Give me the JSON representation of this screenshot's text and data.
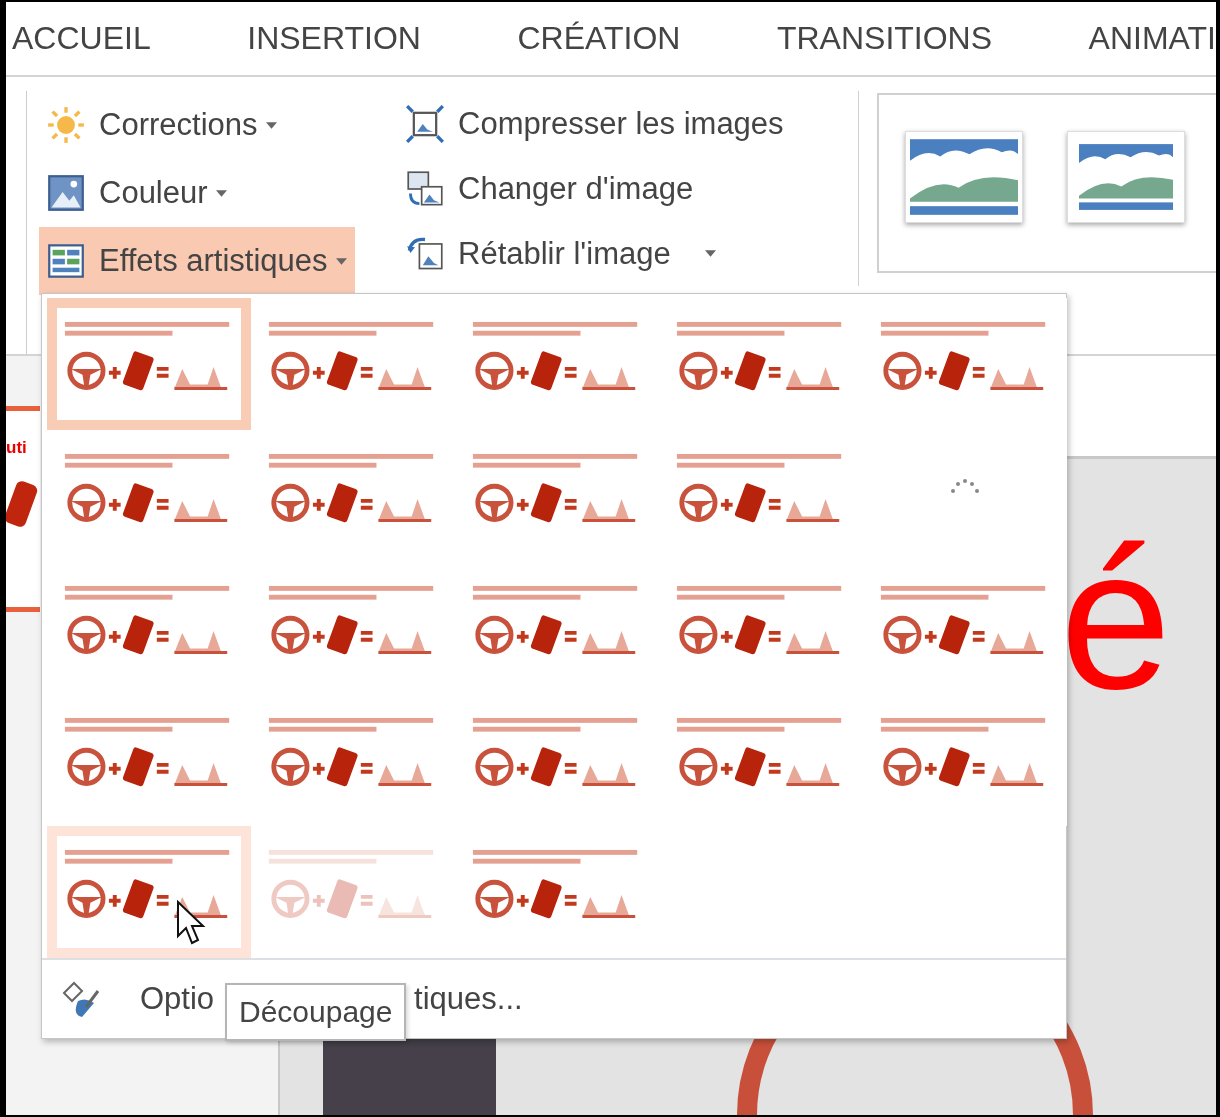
{
  "tabs": [
    {
      "label": "ACCUEIL",
      "selected": false
    },
    {
      "label": "INSERTION",
      "selected": false
    },
    {
      "label": "CRÉATION",
      "selected": false
    },
    {
      "label": "TRANSITIONS",
      "selected": false
    },
    {
      "label": "ANIMATI",
      "selected": false
    }
  ],
  "ribbon": {
    "columns": [
      [
        {
          "kind": "corrections",
          "label": "Corrections",
          "dropdown": true,
          "active": false
        },
        {
          "kind": "color",
          "label": "Couleur",
          "dropdown": true,
          "active": false
        },
        {
          "kind": "artistic",
          "label": "Effets artistiques",
          "dropdown": true,
          "active": true
        }
      ],
      [
        {
          "kind": "compress",
          "label": "Compresser les images",
          "dropdown": false,
          "active": false
        },
        {
          "kind": "change",
          "label": "Changer d'image",
          "dropdown": false,
          "active": false
        },
        {
          "kind": "reset",
          "label": "Rétablir l'image",
          "dropdown": true,
          "active": false
        }
      ]
    ],
    "picture_styles": [
      {
        "kind": "thick-frame"
      },
      {
        "kind": "thin-frame"
      }
    ]
  },
  "effects_menu": {
    "items": [
      {
        "kind": "effect",
        "selected": true,
        "hovered": false
      },
      {
        "kind": "effect",
        "selected": false,
        "hovered": false
      },
      {
        "kind": "effect",
        "selected": false,
        "hovered": false
      },
      {
        "kind": "effect",
        "selected": false,
        "hovered": false
      },
      {
        "kind": "effect",
        "selected": false,
        "hovered": false
      },
      {
        "kind": "effect",
        "selected": false,
        "hovered": false
      },
      {
        "kind": "effect",
        "selected": false,
        "hovered": false
      },
      {
        "kind": "effect",
        "selected": false,
        "hovered": false
      },
      {
        "kind": "effect",
        "selected": false,
        "hovered": false
      },
      {
        "kind": "loading",
        "selected": false,
        "hovered": false
      },
      {
        "kind": "effect",
        "selected": false,
        "hovered": false
      },
      {
        "kind": "effect",
        "selected": false,
        "hovered": false
      },
      {
        "kind": "effect",
        "selected": false,
        "hovered": false
      },
      {
        "kind": "effect",
        "selected": false,
        "hovered": false
      },
      {
        "kind": "effect",
        "selected": false,
        "hovered": false
      },
      {
        "kind": "effect",
        "selected": false,
        "hovered": false
      },
      {
        "kind": "effect",
        "selected": false,
        "hovered": false
      },
      {
        "kind": "effect",
        "selected": false,
        "hovered": false
      },
      {
        "kind": "effect",
        "selected": false,
        "hovered": false
      },
      {
        "kind": "effect",
        "selected": false,
        "hovered": false
      },
      {
        "kind": "effect",
        "selected": false,
        "hovered": true
      },
      {
        "kind": "faded",
        "selected": false,
        "hovered": false
      },
      {
        "kind": "effect",
        "selected": false,
        "hovered": false
      }
    ],
    "options_link": {
      "visible_start": "Optio",
      "visible_end": "tiques..."
    }
  },
  "tooltip": {
    "text": "Découpage"
  },
  "slide": {
    "thumbnail_text": "uti",
    "title_fragment": "é"
  }
}
